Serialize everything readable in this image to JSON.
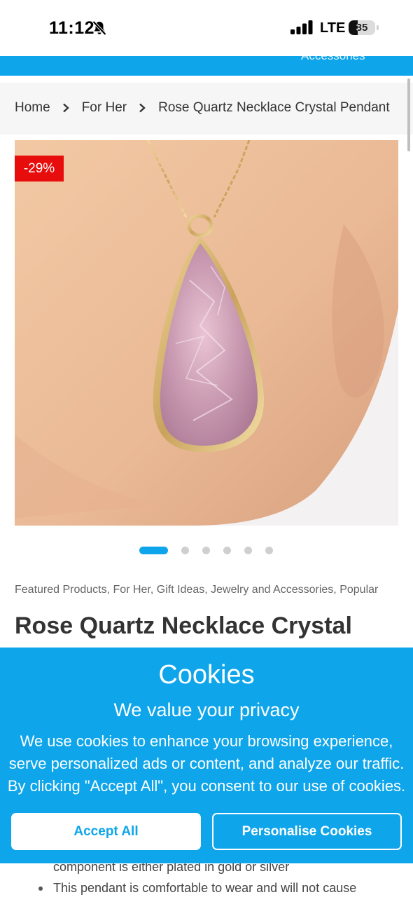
{
  "status_bar": {
    "time": "11:12",
    "network": "LTE",
    "battery_level": "35",
    "battery_fraction": 0.35,
    "icons": [
      "bell-slash-icon",
      "signal-icon",
      "battery-icon"
    ]
  },
  "header": {
    "partial_link": "Accessories",
    "color": "#0ea5ea"
  },
  "breadcrumb": {
    "items": [
      "Home",
      "For Her",
      "Rose Quartz Necklace Crystal Pendant"
    ],
    "separator_icon": "chevron-right-icon"
  },
  "product": {
    "discount": "-29%",
    "categories": "Featured Products, For Her, Gift Ideas, Jewelry and Accessories, Popular",
    "title": "Rose Quartz Necklace Crystal Pendant",
    "image_subject": "rose quartz teardrop pendant on a hand",
    "carousel": {
      "total": 6,
      "active": 1
    },
    "description": [
      "component is either plated in gold or silver",
      "This pendant is comfortable to wear and will not cause"
    ]
  },
  "cookie_banner": {
    "title": "Cookies",
    "subtitle": "We value your privacy",
    "body": "We use cookies to enhance your browsing experience, serve personalized ads or content, and analyze our traffic. By clicking \"Accept All\", you consent to our use of cookies.",
    "accept_label": "Accept All",
    "personalise_label": "Personalise Cookies",
    "color": "#0ea5ea"
  },
  "colors": {
    "accent": "#0ea5ea",
    "badge": "#e80d0d"
  }
}
